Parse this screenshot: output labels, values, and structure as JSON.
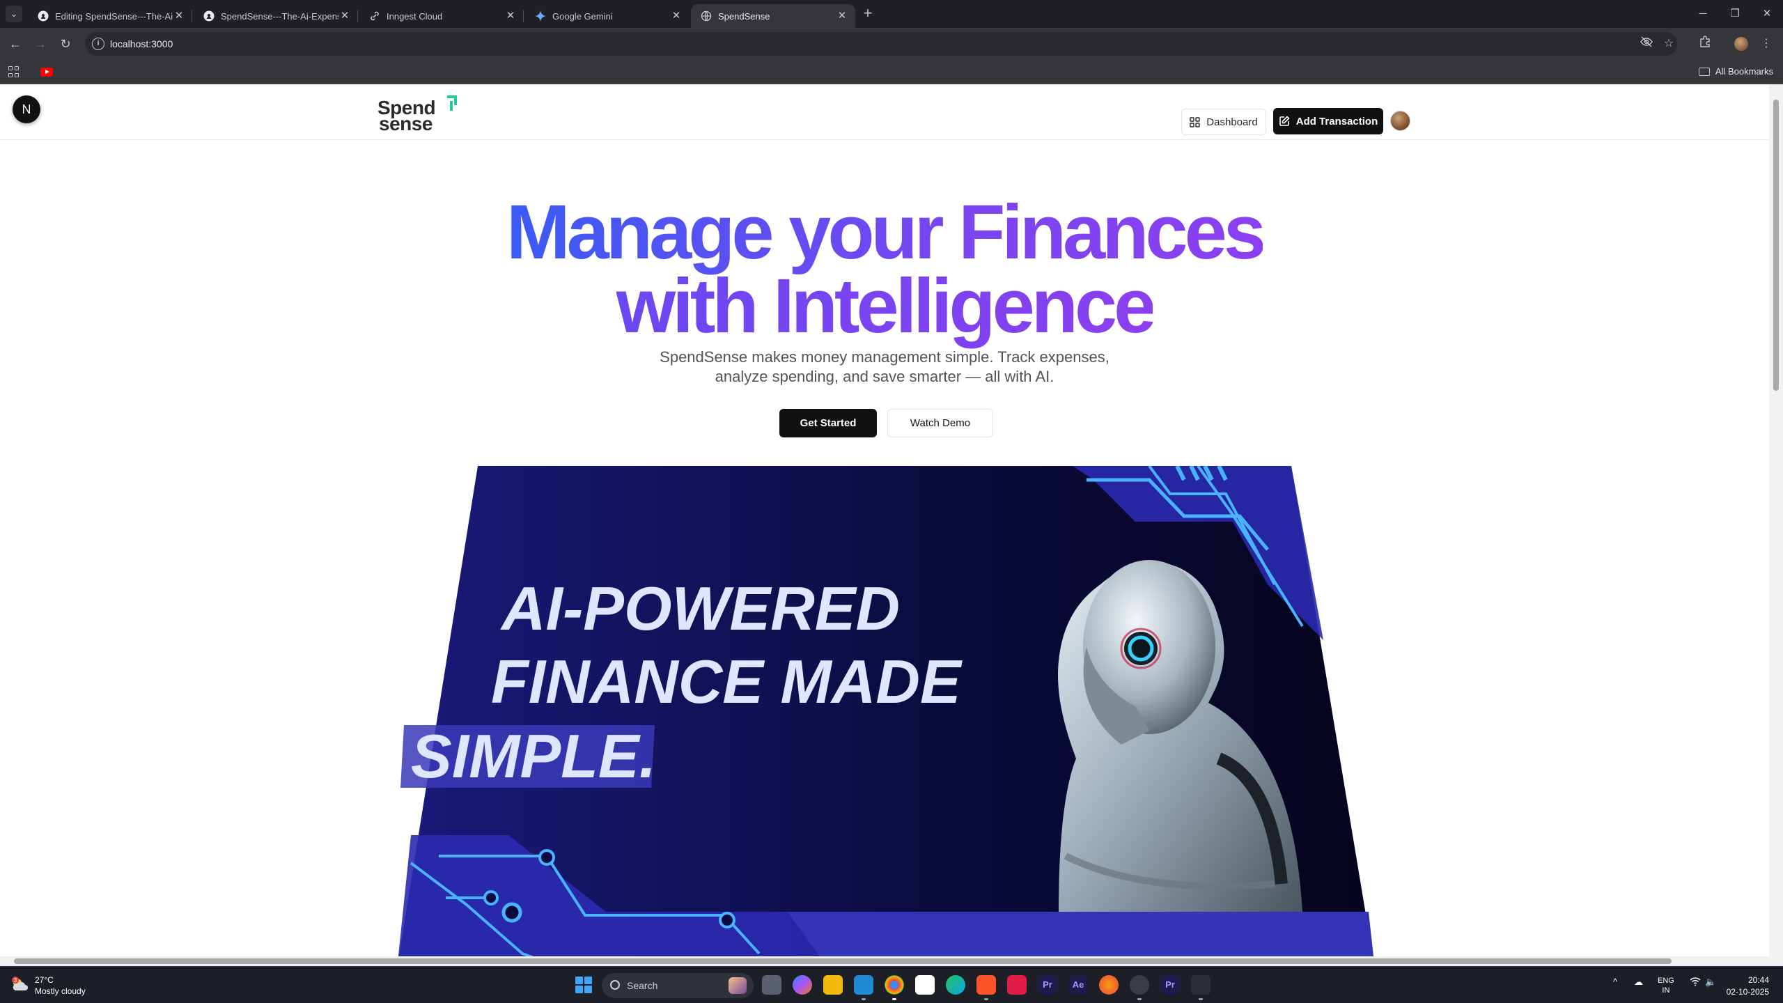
{
  "browser": {
    "tabs": [
      {
        "title": "Editing SpendSense---The-Ai-E",
        "icon": "github-icon",
        "active": false
      },
      {
        "title": "SpendSense---The-Ai-Expense",
        "icon": "github-icon",
        "active": false
      },
      {
        "title": "Inngest Cloud",
        "icon": "link-icon",
        "active": false
      },
      {
        "title": "Google Gemini",
        "icon": "gemini-icon",
        "active": false
      },
      {
        "title": "SpendSense",
        "icon": "globe-icon",
        "active": true
      }
    ],
    "url": "localhost:3000",
    "bookmarks": {
      "all_label": "All Bookmarks"
    }
  },
  "site": {
    "logo": {
      "line1": "Spend",
      "line2": "sense"
    },
    "nav": {
      "dashboard": "Dashboard",
      "add_transaction": "Add Transaction"
    },
    "hero": {
      "title_line1": "Manage your Finances",
      "title_line2": "with Intelligence",
      "subtitle_line1": "SpendSense makes money management simple. Track expenses,",
      "subtitle_line2": "analyze spending, and save smarter — all with AI.",
      "cta_primary": "Get Started",
      "cta_secondary": "Watch Demo"
    },
    "banner": {
      "line1": "AI-POWERED",
      "line2": "FINANCE MADE",
      "line3": "SIMPLE."
    },
    "dev_badge": "N"
  },
  "taskbar": {
    "weather": {
      "temp": "27°C",
      "condition": "Mostly cloudy",
      "alert_count": "3"
    },
    "search_label": "Search",
    "lang": {
      "line1": "ENG",
      "line2": "IN"
    },
    "time": "20:44",
    "date": "02-10-2025"
  },
  "colors": {
    "hero_gradient_start": "#3b5bf5",
    "hero_gradient_end": "#8b3ff0",
    "banner_bg": "#0f0f55",
    "banner_accent": "#3a8cff",
    "primary_button": "#111111"
  }
}
